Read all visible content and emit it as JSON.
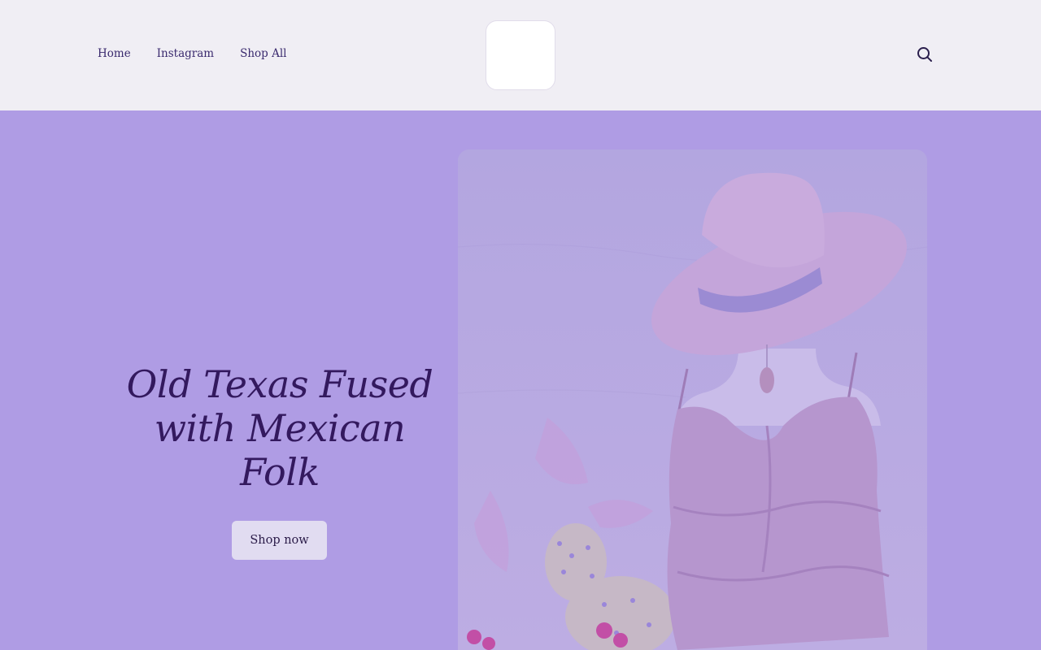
{
  "nav": {
    "items": [
      {
        "label": "Home"
      },
      {
        "label": "Instagram"
      },
      {
        "label": "Shop All"
      }
    ]
  },
  "header": {
    "search_icon": "search-icon",
    "logo": "logo-placeholder"
  },
  "hero": {
    "title": "Old Texas Fused with Mexican Folk",
    "cta_label": "Shop now",
    "image": "hero-photo-hat-mannequin-ruffled-top-cactus"
  },
  "colors": {
    "header_bg": "#F0EEF4",
    "hero_bg": "#AF9CE4",
    "title_color": "#33195E",
    "nav_text": "#3A2A6E",
    "button_bg": "#E1DCF1"
  }
}
